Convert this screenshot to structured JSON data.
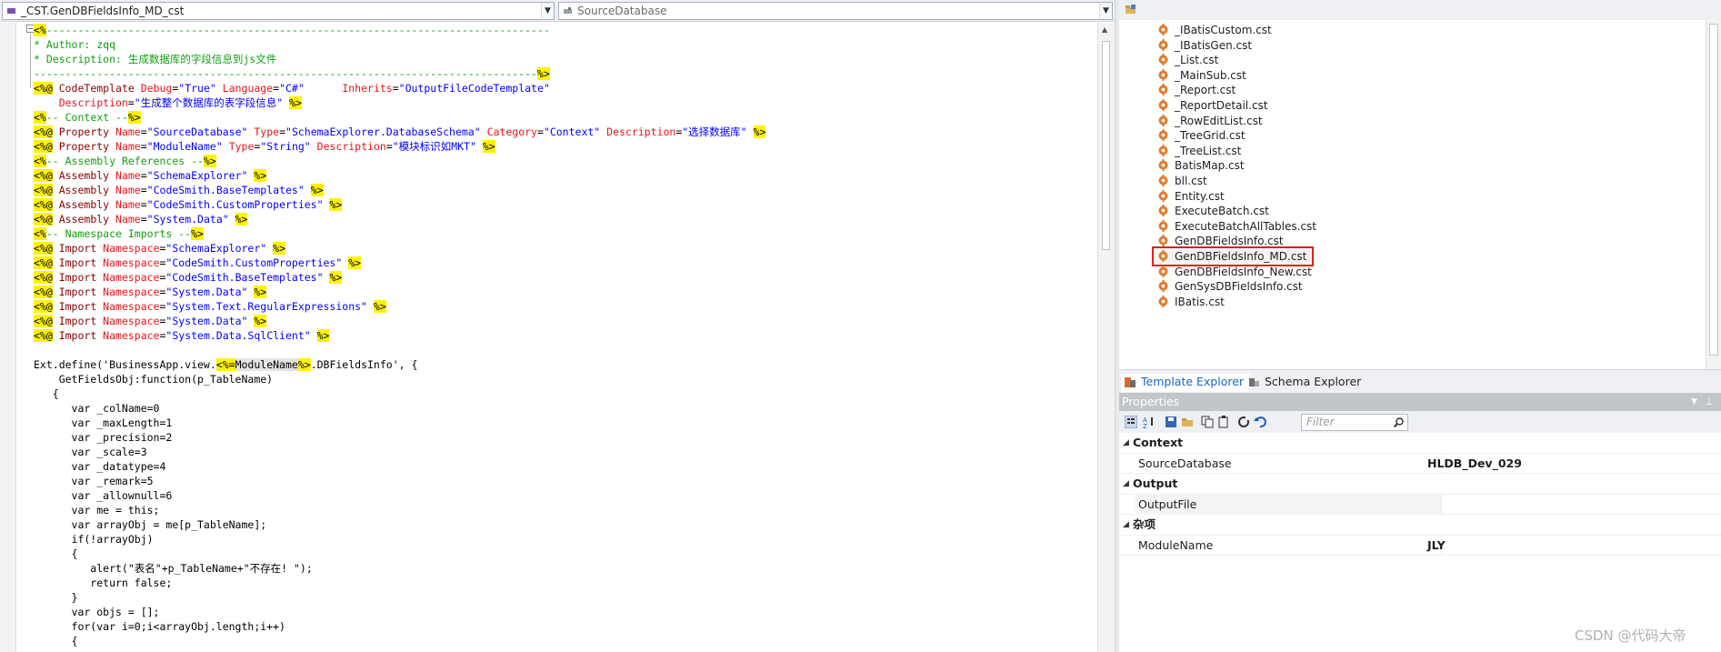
{
  "toolbar": {
    "template_selector": "_CST.GenDBFieldsInfo_MD_cst",
    "member_selector": "SourceDatabase"
  },
  "code_lines": [
    [
      {
        "t": "<%",
        "c": "hl"
      },
      {
        "t": "--------------------------------------------------------------------------------",
        "c": "g"
      }
    ],
    [
      {
        "t": "* Author: zqq",
        "c": "g"
      }
    ],
    [
      {
        "t": "* Description: 生成数据库的字段信息到js文件",
        "c": "g"
      }
    ],
    [
      {
        "t": "--------------------------------------------------------------------------------",
        "c": "g"
      },
      {
        "t": "%>",
        "c": "hl"
      }
    ],
    [
      {
        "t": "<%@",
        "c": "hl"
      },
      {
        "t": " CodeTemplate ",
        "c": "m"
      },
      {
        "t": "Debug",
        "c": "r"
      },
      {
        "t": "=",
        "c": ""
      },
      {
        "t": "\"True\"",
        "c": "b"
      },
      {
        "t": " Language",
        "c": "r"
      },
      {
        "t": "=",
        "c": ""
      },
      {
        "t": "\"C#\"",
        "c": "b"
      },
      {
        "t": "      Inherits",
        "c": "r"
      },
      {
        "t": "=",
        "c": ""
      },
      {
        "t": "\"OutputFileCodeTemplate\"",
        "c": "b"
      }
    ],
    [
      {
        "t": "    Description",
        "c": "r"
      },
      {
        "t": "=",
        "c": ""
      },
      {
        "t": "\"生成整个数据库的表字段信息\"",
        "c": "b"
      },
      {
        "t": " ",
        "c": ""
      },
      {
        "t": "%>",
        "c": "hl"
      }
    ],
    [
      {
        "t": "<%",
        "c": "hl"
      },
      {
        "t": "-- Context --",
        "c": "g"
      },
      {
        "t": "%>",
        "c": "hl"
      }
    ],
    [
      {
        "t": "<%@",
        "c": "hl"
      },
      {
        "t": " Property ",
        "c": "m"
      },
      {
        "t": "Name",
        "c": "r"
      },
      {
        "t": "=",
        "c": ""
      },
      {
        "t": "\"SourceDatabase\"",
        "c": "b"
      },
      {
        "t": " Type",
        "c": "r"
      },
      {
        "t": "=",
        "c": ""
      },
      {
        "t": "\"SchemaExplorer.DatabaseSchema\"",
        "c": "b"
      },
      {
        "t": " Category",
        "c": "r"
      },
      {
        "t": "=",
        "c": ""
      },
      {
        "t": "\"Context\"",
        "c": "b"
      },
      {
        "t": " Description",
        "c": "r"
      },
      {
        "t": "=",
        "c": ""
      },
      {
        "t": "\"选择数据库\"",
        "c": "b"
      },
      {
        "t": " ",
        "c": ""
      },
      {
        "t": "%>",
        "c": "hl"
      }
    ],
    [
      {
        "t": "<%@",
        "c": "hl"
      },
      {
        "t": " Property ",
        "c": "m"
      },
      {
        "t": "Name",
        "c": "r"
      },
      {
        "t": "=",
        "c": ""
      },
      {
        "t": "\"ModuleName\"",
        "c": "b"
      },
      {
        "t": " Type",
        "c": "r"
      },
      {
        "t": "=",
        "c": ""
      },
      {
        "t": "\"String\"",
        "c": "b"
      },
      {
        "t": " Description",
        "c": "r"
      },
      {
        "t": "=",
        "c": ""
      },
      {
        "t": "\"模块标识如MKT\"",
        "c": "b"
      },
      {
        "t": " ",
        "c": ""
      },
      {
        "t": "%>",
        "c": "hl"
      }
    ],
    [
      {
        "t": "<%",
        "c": "hl"
      },
      {
        "t": "-- Assembly References --",
        "c": "g"
      },
      {
        "t": "%>",
        "c": "hl"
      }
    ],
    [
      {
        "t": "<%@",
        "c": "hl"
      },
      {
        "t": " Assembly ",
        "c": "m"
      },
      {
        "t": "Name",
        "c": "r"
      },
      {
        "t": "=",
        "c": ""
      },
      {
        "t": "\"SchemaExplorer\"",
        "c": "b"
      },
      {
        "t": " ",
        "c": ""
      },
      {
        "t": "%>",
        "c": "hl"
      }
    ],
    [
      {
        "t": "<%@",
        "c": "hl"
      },
      {
        "t": " Assembly ",
        "c": "m"
      },
      {
        "t": "Name",
        "c": "r"
      },
      {
        "t": "=",
        "c": ""
      },
      {
        "t": "\"CodeSmith.BaseTemplates\"",
        "c": "b"
      },
      {
        "t": " ",
        "c": ""
      },
      {
        "t": "%>",
        "c": "hl"
      }
    ],
    [
      {
        "t": "<%@",
        "c": "hl"
      },
      {
        "t": " Assembly ",
        "c": "m"
      },
      {
        "t": "Name",
        "c": "r"
      },
      {
        "t": "=",
        "c": ""
      },
      {
        "t": "\"CodeSmith.CustomProperties\"",
        "c": "b"
      },
      {
        "t": " ",
        "c": ""
      },
      {
        "t": "%>",
        "c": "hl"
      }
    ],
    [
      {
        "t": "<%@",
        "c": "hl"
      },
      {
        "t": " Assembly ",
        "c": "m"
      },
      {
        "t": "Name",
        "c": "r"
      },
      {
        "t": "=",
        "c": ""
      },
      {
        "t": "\"System.Data\"",
        "c": "b"
      },
      {
        "t": " ",
        "c": ""
      },
      {
        "t": "%>",
        "c": "hl"
      }
    ],
    [
      {
        "t": "<%",
        "c": "hl"
      },
      {
        "t": "-- Namespace Imports --",
        "c": "g"
      },
      {
        "t": "%>",
        "c": "hl"
      }
    ],
    [
      {
        "t": "<%@",
        "c": "hl"
      },
      {
        "t": " Import ",
        "c": "m"
      },
      {
        "t": "Namespace",
        "c": "r"
      },
      {
        "t": "=",
        "c": ""
      },
      {
        "t": "\"SchemaExplorer\"",
        "c": "b"
      },
      {
        "t": " ",
        "c": ""
      },
      {
        "t": "%>",
        "c": "hl"
      }
    ],
    [
      {
        "t": "<%@",
        "c": "hl"
      },
      {
        "t": " Import ",
        "c": "m"
      },
      {
        "t": "Namespace",
        "c": "r"
      },
      {
        "t": "=",
        "c": ""
      },
      {
        "t": "\"CodeSmith.CustomProperties\"",
        "c": "b"
      },
      {
        "t": " ",
        "c": ""
      },
      {
        "t": "%>",
        "c": "hl"
      }
    ],
    [
      {
        "t": "<%@",
        "c": "hl"
      },
      {
        "t": " Import ",
        "c": "m"
      },
      {
        "t": "Namespace",
        "c": "r"
      },
      {
        "t": "=",
        "c": ""
      },
      {
        "t": "\"CodeSmith.BaseTemplates\"",
        "c": "b"
      },
      {
        "t": " ",
        "c": ""
      },
      {
        "t": "%>",
        "c": "hl"
      }
    ],
    [
      {
        "t": "<%@",
        "c": "hl"
      },
      {
        "t": " Import ",
        "c": "m"
      },
      {
        "t": "Namespace",
        "c": "r"
      },
      {
        "t": "=",
        "c": ""
      },
      {
        "t": "\"System.Data\"",
        "c": "b"
      },
      {
        "t": " ",
        "c": ""
      },
      {
        "t": "%>",
        "c": "hl"
      }
    ],
    [
      {
        "t": "<%@",
        "c": "hl"
      },
      {
        "t": " Import ",
        "c": "m"
      },
      {
        "t": "Namespace",
        "c": "r"
      },
      {
        "t": "=",
        "c": ""
      },
      {
        "t": "\"System.Text.RegularExpressions\"",
        "c": "b"
      },
      {
        "t": " ",
        "c": ""
      },
      {
        "t": "%>",
        "c": "hl"
      }
    ],
    [
      {
        "t": "<%@",
        "c": "hl"
      },
      {
        "t": " Import ",
        "c": "m"
      },
      {
        "t": "Namespace",
        "c": "r"
      },
      {
        "t": "=",
        "c": ""
      },
      {
        "t": "\"System.Data\"",
        "c": "b"
      },
      {
        "t": " ",
        "c": ""
      },
      {
        "t": "%>",
        "c": "hl"
      }
    ],
    [
      {
        "t": "<%@",
        "c": "hl"
      },
      {
        "t": " Import ",
        "c": "m"
      },
      {
        "t": "Namespace",
        "c": "r"
      },
      {
        "t": "=",
        "c": ""
      },
      {
        "t": "\"System.Data.SqlClient\"",
        "c": "b"
      },
      {
        "t": " ",
        "c": ""
      },
      {
        "t": "%>",
        "c": "hl"
      }
    ],
    [
      {
        "t": "",
        "c": ""
      }
    ],
    [
      {
        "t": "Ext.define('BusinessApp.view.",
        "c": ""
      },
      {
        "t": "<%=",
        "c": "hl"
      },
      {
        "t": "ModuleName",
        "c": "sel"
      },
      {
        "t": "%>",
        "c": "hl"
      },
      {
        "t": ".DBFieldsInfo', {",
        "c": ""
      }
    ],
    [
      {
        "t": "    GetFieldsObj:function(p_TableName)",
        "c": ""
      }
    ],
    [
      {
        "t": "   {",
        "c": ""
      }
    ],
    [
      {
        "t": "      var _colName=0",
        "c": ""
      }
    ],
    [
      {
        "t": "      var _maxLength=1",
        "c": ""
      }
    ],
    [
      {
        "t": "      var _precision=2",
        "c": ""
      }
    ],
    [
      {
        "t": "      var _scale=3",
        "c": ""
      }
    ],
    [
      {
        "t": "      var _datatype=4",
        "c": ""
      }
    ],
    [
      {
        "t": "      var _remark=5",
        "c": ""
      }
    ],
    [
      {
        "t": "      var _allownull=6",
        "c": ""
      }
    ],
    [
      {
        "t": "      var me = this;",
        "c": ""
      }
    ],
    [
      {
        "t": "      var arrayObj = me[p_TableName];",
        "c": ""
      }
    ],
    [
      {
        "t": "      if(!arrayObj)",
        "c": ""
      }
    ],
    [
      {
        "t": "      {",
        "c": ""
      }
    ],
    [
      {
        "t": "         alert(\"表名\"+p_TableName+\"不存在! \");",
        "c": ""
      }
    ],
    [
      {
        "t": "         return false;",
        "c": ""
      }
    ],
    [
      {
        "t": "      }",
        "c": ""
      }
    ],
    [
      {
        "t": "      var objs = [];",
        "c": ""
      }
    ],
    [
      {
        "t": "      for(var i=0;i<arrayObj.length;i++)",
        "c": ""
      }
    ],
    [
      {
        "t": "      {",
        "c": ""
      }
    ]
  ],
  "explorer": {
    "files": [
      "_IBatisCustom.cst",
      "_IBatisGen.cst",
      "_List.cst",
      "_MainSub.cst",
      "_Report.cst",
      "_ReportDetail.cst",
      "_RowEditList.cst",
      "_TreeGrid.cst",
      "_TreeList.cst",
      "BatisMap.cst",
      "bll.cst",
      "Entity.cst",
      "ExecuteBatch.cst",
      "ExecuteBatchAllTables.cst",
      "GenDBFieldsInfo.cst",
      "GenDBFieldsInfo_MD.cst",
      "GenDBFieldsInfo_New.cst",
      "GenSysDBFieldsInfo.cst",
      "IBatis.cst"
    ],
    "selected_file": "GenDBFieldsInfo_MD.cst",
    "tabs": {
      "template": "Template Explorer",
      "schema": "Schema Explorer"
    }
  },
  "properties": {
    "title": "Properties",
    "filter_placeholder": "Filter",
    "categories": {
      "context": "Context",
      "output": "Output",
      "misc": "杂项"
    },
    "rows": {
      "source_database": {
        "name": "SourceDatabase",
        "value": "HLDB_Dev_029"
      },
      "output_file": {
        "name": "OutputFile",
        "value": ""
      },
      "module_name": {
        "name": "ModuleName",
        "value": "JLY"
      }
    }
  },
  "watermark": "CSDN @代码大帝",
  "colors": {
    "comment": "#11a011",
    "keyword": "#8b0000",
    "attribute": "#e8141a",
    "string": "#0000ff",
    "delimiter_bg": "#fff200",
    "selected_outline": "#e01e1e",
    "link_tab": "#1b65c8"
  }
}
